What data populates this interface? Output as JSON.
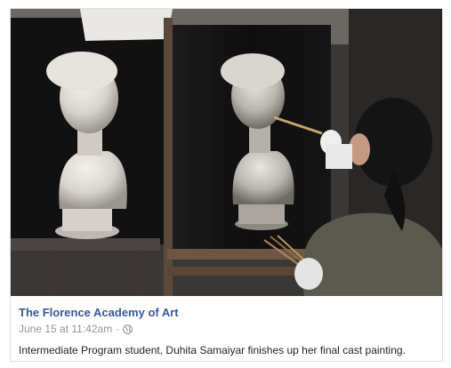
{
  "post": {
    "page_name": "The Florence Academy of Art",
    "timestamp": "June 15 at 11:42am",
    "separator": "·",
    "privacy_icon": "globe-icon",
    "caption": "Intermediate Program student, Duhita Samaiyar finishes up her final cast painting."
  },
  "colors": {
    "link": "#365899",
    "meta": "#90949c",
    "text": "#1d2129",
    "border": "#dddfe2"
  }
}
